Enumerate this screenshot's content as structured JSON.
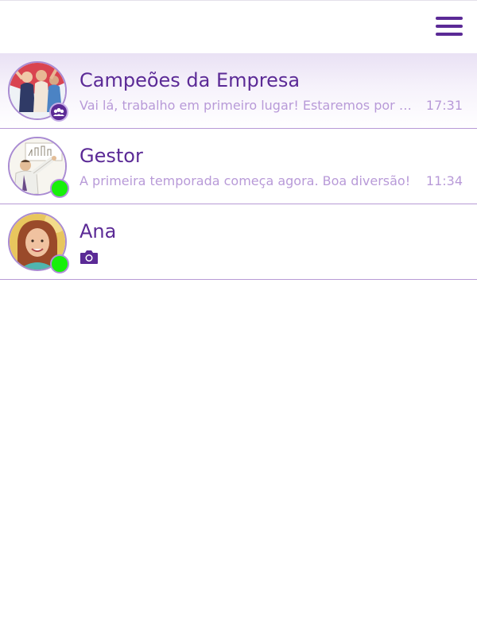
{
  "header": {
    "menu_icon": "hamburger-menu-icon"
  },
  "chats": [
    {
      "name": "Campeões da Empresa",
      "preview": "Vai lá, trabalho em primeiro lugar! Estaremos por aq...",
      "time": "17:31",
      "type": "group",
      "active": true,
      "badge_icon": "group-icon"
    },
    {
      "name": "Gestor",
      "preview": "A primeira temporada começa agora. Boa diversão!",
      "time": "11:34",
      "type": "contact",
      "online": true
    },
    {
      "name": "Ana",
      "preview_icon": "camera-icon",
      "type": "contact",
      "online": true
    }
  ],
  "colors": {
    "accent": "#5b2a96",
    "preview_text": "#b89ad8",
    "online": "#17f00a",
    "divider": "#b79ad6"
  }
}
